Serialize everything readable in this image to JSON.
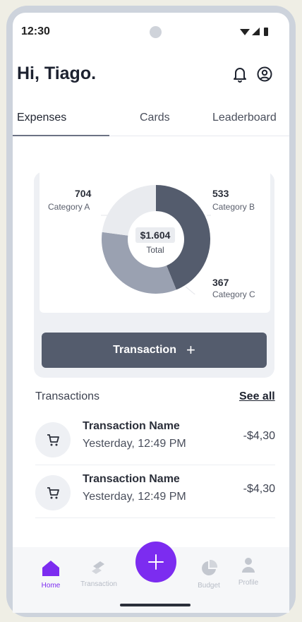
{
  "status_bar": {
    "time": "12:30"
  },
  "header": {
    "greeting": "Hi, Tiago."
  },
  "tabs": [
    {
      "label": "Expenses"
    },
    {
      "label": "Cards"
    },
    {
      "label": "Leaderboard"
    }
  ],
  "summary": {
    "total_amount": "$1.604",
    "total_label": "Total",
    "categories": [
      {
        "value": "704",
        "label": "Category A",
        "color": "#545c6d"
      },
      {
        "value": "533",
        "label": "Category B",
        "color": "#9aa1b1"
      },
      {
        "value": "367",
        "label": "Category C",
        "color": "#e9ebef"
      }
    ],
    "button_label": "Transaction"
  },
  "transactions": {
    "title": "Transactions",
    "see_all": "See all",
    "items": [
      {
        "name": "Transaction Name",
        "time": "Yesterday, 12:49 PM",
        "amount": "-$4,30"
      },
      {
        "name": "Transaction Name",
        "time": "Yesterday, 12:49 PM",
        "amount": "-$4,30"
      }
    ]
  },
  "nav": [
    {
      "label": "Home",
      "icon": "home-icon",
      "active": true
    },
    {
      "label": "Transaction",
      "icon": "transfer-icon"
    },
    {
      "label": "Budget",
      "icon": "pie-chart-icon"
    },
    {
      "label": "Profile",
      "icon": "profile-icon"
    }
  ],
  "colors": {
    "accent": "#7c2cf0",
    "primary": "#545c6d"
  }
}
